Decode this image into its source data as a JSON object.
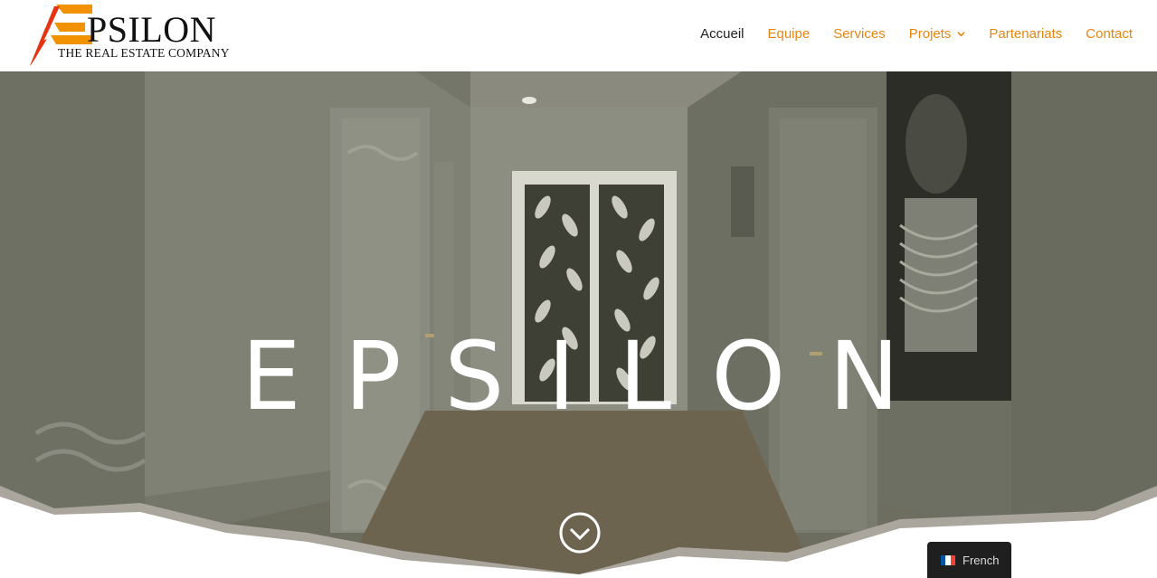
{
  "brand": {
    "name": "PSILON",
    "tagline": "THE REAL ESTATE COMPANY",
    "accent_color": "#e8850f",
    "logo_red": "#e63312",
    "logo_orange": "#f39200"
  },
  "nav": {
    "items": [
      {
        "label": "Accueil",
        "active": true
      },
      {
        "label": "Equipe"
      },
      {
        "label": "Services"
      },
      {
        "label": "Projets",
        "has_dropdown": true,
        "icon": "chevron-down-icon"
      },
      {
        "label": "Partenariats"
      },
      {
        "label": "Contact"
      }
    ]
  },
  "hero": {
    "title": "EPSILON",
    "scroll_icon": "chevron-circle-down-icon"
  },
  "language": {
    "label": "French",
    "flag_icon": "france-flag-icon"
  }
}
